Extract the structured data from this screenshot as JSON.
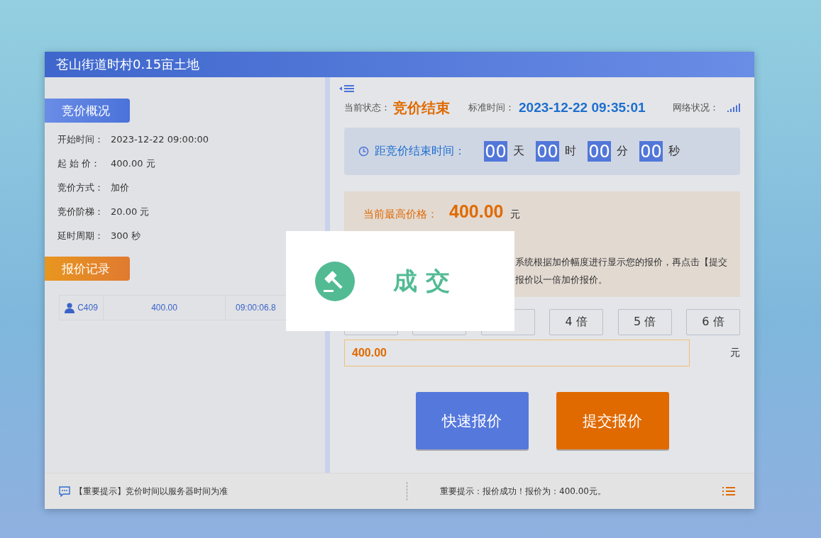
{
  "window": {
    "title": "苍山街道时村0.15亩土地"
  },
  "overview": {
    "heading": "竞价概况",
    "rows": [
      {
        "label": "开始时间：",
        "value": "2023-12-22 09:00:00"
      },
      {
        "label": "起 始 价：",
        "value": "400.00 元"
      },
      {
        "label": "竞价方式：",
        "value": "加价"
      },
      {
        "label": "竞价阶梯：",
        "value": "20.00 元"
      },
      {
        "label": "延时周期：",
        "value": "300 秒"
      }
    ]
  },
  "records": {
    "heading": "报价记录",
    "rows": [
      {
        "bidder": "C409",
        "price": "400.00",
        "time": "09:00:06.8"
      }
    ]
  },
  "status": {
    "label": "当前状态：",
    "value": "竞价结束",
    "time_label": "标准时间：",
    "time": "2023-12-22 09:35:01",
    "network_label": "网络状况："
  },
  "countdown": {
    "label": "距竞价结束时间：",
    "units": [
      {
        "value": "00",
        "unit": "天"
      },
      {
        "value": "00",
        "unit": "时"
      },
      {
        "value": "00",
        "unit": "分"
      },
      {
        "value": "00",
        "unit": "秒"
      }
    ]
  },
  "price": {
    "label": "当前最高价格：",
    "value": "400.00",
    "unit": "元",
    "hint_lines": [
      "系统根据加价幅度进行显示您的报价，再点击【提交",
      "报价以一倍加价报价。"
    ]
  },
  "multipliers": [
    {
      "kind": "covered"
    },
    {
      "kind": "covered"
    },
    {
      "kind": "covered"
    },
    {
      "kind": "button",
      "label": "4 倍"
    },
    {
      "kind": "button",
      "label": "5 倍"
    },
    {
      "kind": "button",
      "label": "6 倍"
    }
  ],
  "bid": {
    "value": "400.00",
    "unit": "元"
  },
  "actions": [
    {
      "kind": "quick",
      "label": "快速报价"
    },
    {
      "kind": "submit",
      "label": "提交报价"
    }
  ],
  "footer": {
    "left": "【重要提示】竞价时间以服务器时间为准",
    "right": "重要提示：报价成功！报价为：400.00元。"
  },
  "popup": {
    "text": "成 交"
  }
}
